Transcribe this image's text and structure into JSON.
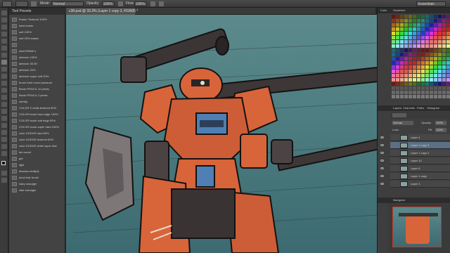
{
  "options_bar": {
    "mode_label": "Mode:",
    "mode_value": "Normal",
    "opacity_label": "Opacity:",
    "opacity_value": "100%",
    "flow_label": "Flow:",
    "flow_value": "100%",
    "workspace_value": "Essentials"
  },
  "presets_panel": {
    "tab_label": "Tool Presets",
    "items": [
      {
        "label": "Eraser Textured 100%"
      },
      {
        "label": "hard eraser"
      },
      {
        "label": "soft 100%"
      },
      {
        "label": "soft 20% eraser"
      },
      {
        "label": ""
      },
      {
        "label": "hard DRAW s"
      },
      {
        "label": "airbrush 100%"
      },
      {
        "label": "airbrush 30-50"
      },
      {
        "label": "airbrush 20%"
      },
      {
        "label": "airbrush super soft 20%"
      },
      {
        "label": "brush hard round pressure"
      },
      {
        "label": "Brush PENCIL 10 pixels"
      },
      {
        "label": "Brush PENCIL 2 pixels"
      },
      {
        "label": "chevily"
      },
      {
        "label": "COLOR S chalk textured 50%"
      },
      {
        "label": "COLOR brush hard edge 100%"
      },
      {
        "label": "COLOR brush soft edge 50%"
      },
      {
        "label": "COLOR brush super hard 100%"
      },
      {
        "label": "color DODGE hard 60%"
      },
      {
        "label": "color DODGE textured 50%"
      },
      {
        "label": "color DODGE white super fast"
      },
      {
        "label": "fan round"
      },
      {
        "label": "grit"
      },
      {
        "label": "light"
      },
      {
        "label": "shadow multiply"
      },
      {
        "label": "short hair brush"
      },
      {
        "label": "hairy smudger"
      },
      {
        "label": "rake smudger"
      }
    ]
  },
  "document": {
    "tab_label": "c38.psd @ 33.3% (Layer 1 copy 3, RGB/8) *"
  },
  "right_panel": {
    "color_tabs": [
      "Color",
      "Swatches"
    ],
    "layer_tabs": [
      "Layers",
      "Channels",
      "Paths",
      "Histogram"
    ],
    "blend_mode": "Normal",
    "opacity_label": "Opacity:",
    "opacity_value": "100%",
    "lock_label": "Lock:",
    "fill_label": "Fill:",
    "fill_value": "100%",
    "layers": [
      {
        "name": "Layer 4",
        "selected": false
      },
      {
        "name": "Layer 1 copy 3",
        "selected": true
      },
      {
        "name": "Layer 1 copy 2",
        "selected": false
      },
      {
        "name": "Layer 10",
        "selected": false
      },
      {
        "name": "Layer 6",
        "selected": false
      },
      {
        "name": "Layer 1 copy",
        "selected": false
      },
      {
        "name": "Layer 1",
        "selected": false
      }
    ],
    "navigator_tab": "Navigator"
  },
  "colors": {
    "canvas_top": "#5c8a8c",
    "canvas_bottom": "#3c6a70",
    "mech_orange": "#d8643a",
    "mech_dark": "#3a3334",
    "accent_blue": "#4f7fb3"
  }
}
